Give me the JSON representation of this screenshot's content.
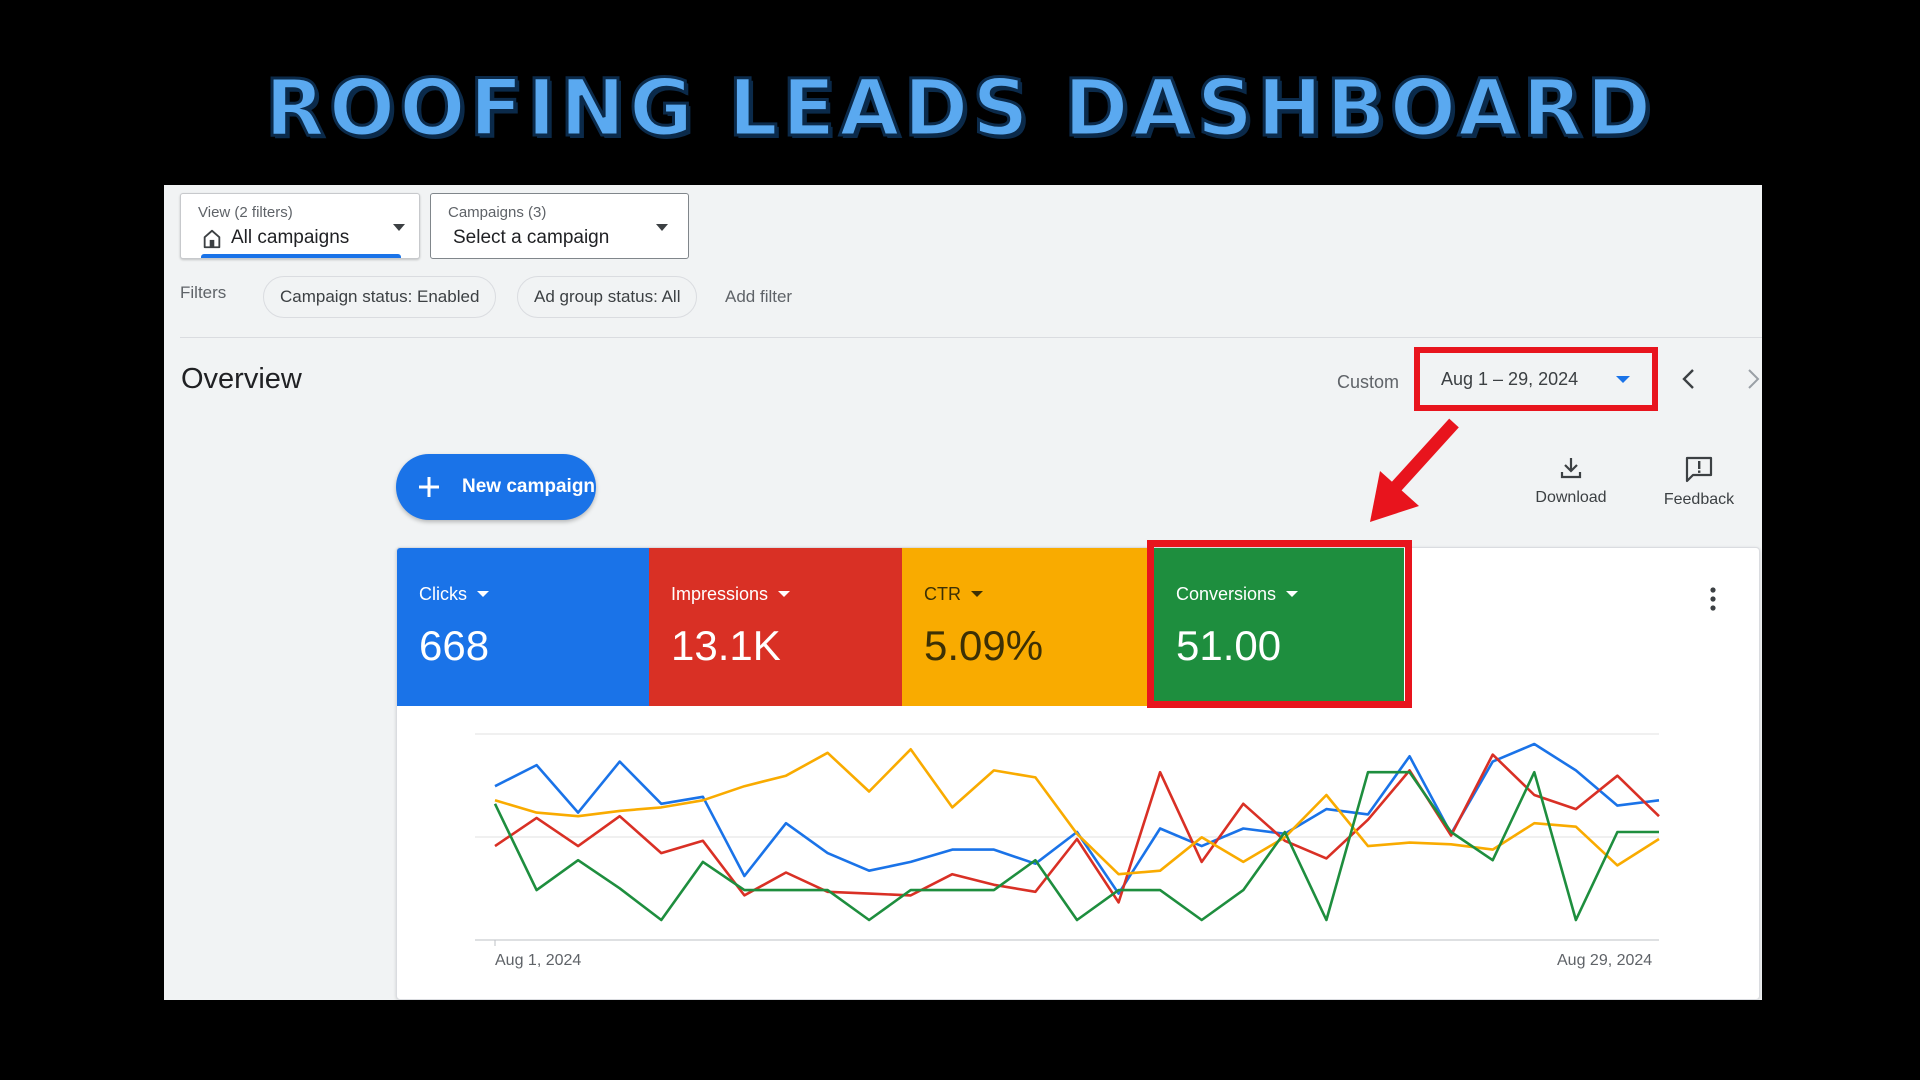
{
  "banner": {
    "title": "ROOFING LEADS DASHBOARD"
  },
  "toolbar": {
    "view": {
      "label": "View (2 filters)",
      "value": "All campaigns",
      "icon": "house-icon"
    },
    "campaigns": {
      "label": "Campaigns (3)",
      "value": "Select a campaign"
    }
  },
  "filters": {
    "label": "Filters",
    "chips": [
      "Campaign status: Enabled",
      "Ad group status: All"
    ],
    "add_label": "Add filter"
  },
  "overview": {
    "title": "Overview",
    "range_label": "Custom",
    "date_range": "Aug 1 – 29, 2024",
    "new_campaign_label": "New campaign",
    "download_label": "Download",
    "feedback_label": "Feedback"
  },
  "metrics": [
    {
      "label": "Clicks",
      "value": "668",
      "color": "#1a73e8"
    },
    {
      "label": "Impressions",
      "value": "13.1K",
      "color": "#d93025"
    },
    {
      "label": "CTR",
      "value": "5.09%",
      "color": "#f9ab00"
    },
    {
      "label": "Conversions",
      "value": "51.00",
      "color": "#1e8e3e"
    }
  ],
  "highlight_color": "#e8141d",
  "chart_data": {
    "type": "line",
    "x_start_label": "Aug 1, 2024",
    "x_end_label": "Aug 29, 2024",
    "grid": "horizontal",
    "normalized": true,
    "ylim": [
      0,
      1
    ],
    "series": [
      {
        "color": "#1a73e8",
        "values": [
          0.76,
          0.88,
          0.61,
          0.9,
          0.66,
          0.7,
          0.25,
          0.55,
          0.38,
          0.28,
          0.33,
          0.4,
          0.4,
          0.32,
          0.5,
          0.15,
          0.52,
          0.42,
          0.52,
          0.49,
          0.63,
          0.6,
          0.93,
          0.49,
          0.9,
          1.0,
          0.85,
          0.65,
          0.68
        ]
      },
      {
        "color": "#d93025",
        "values": [
          0.42,
          0.58,
          0.42,
          0.59,
          0.38,
          0.45,
          0.14,
          0.27,
          0.16,
          0.15,
          0.14,
          0.26,
          0.2,
          0.16,
          0.46,
          0.1,
          0.84,
          0.33,
          0.66,
          0.45,
          0.35,
          0.57,
          0.85,
          0.48,
          0.94,
          0.71,
          0.63,
          0.82,
          0.59
        ]
      },
      {
        "color": "#f9ab00",
        "values": [
          0.68,
          0.61,
          0.59,
          0.62,
          0.64,
          0.68,
          0.76,
          0.82,
          0.95,
          0.73,
          0.97,
          0.64,
          0.85,
          0.81,
          0.49,
          0.26,
          0.28,
          0.47,
          0.33,
          0.47,
          0.71,
          0.42,
          0.44,
          0.43,
          0.4,
          0.55,
          0.53,
          0.31,
          0.46
        ]
      },
      {
        "color": "#1e8e3e",
        "values": [
          0.66,
          0.17,
          0.34,
          0.18,
          0.0,
          0.33,
          0.17,
          0.17,
          0.17,
          0.0,
          0.17,
          0.17,
          0.17,
          0.34,
          0.0,
          0.17,
          0.17,
          0.0,
          0.17,
          0.5,
          0.0,
          0.84,
          0.84,
          0.5,
          0.34,
          0.84,
          0.0,
          0.5,
          0.5
        ]
      }
    ]
  }
}
